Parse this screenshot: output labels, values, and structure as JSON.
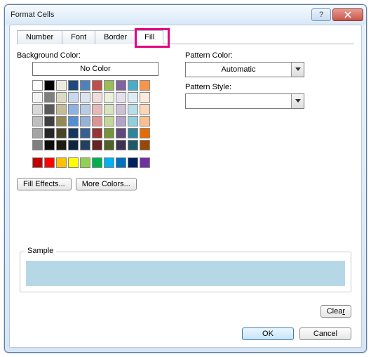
{
  "window": {
    "title": "Format Cells"
  },
  "tabs": {
    "number": "Number",
    "font": "Font",
    "border": "Border",
    "fill": "Fill",
    "active": "fill"
  },
  "fill": {
    "bg_label": "Background Color:",
    "no_color": "No Color",
    "effects_btn": "Fill Effects...",
    "more_colors_btn": "More Colors...",
    "selected_color": "#b6d8e6",
    "theme_colors": [
      [
        "#ffffff",
        "#000000",
        "#eeece1",
        "#1f497d",
        "#4f81bd",
        "#c0504d",
        "#9bbb59",
        "#8064a2",
        "#4bacc6",
        "#f79646"
      ],
      [
        "#f2f2f2",
        "#7f7f7f",
        "#ddd9c3",
        "#c6d9f0",
        "#dbe5f1",
        "#f2dcdb",
        "#ebf1dd",
        "#e5e0ec",
        "#dbeef3",
        "#fdeada"
      ],
      [
        "#d8d8d8",
        "#595959",
        "#c4bd97",
        "#8db3e2",
        "#b8cce4",
        "#e5b9b7",
        "#d7e3bc",
        "#ccc1d9",
        "#b7dde8",
        "#fbd5b5"
      ],
      [
        "#bfbfbf",
        "#3f3f3f",
        "#938953",
        "#548dd4",
        "#95b3d7",
        "#d99694",
        "#c3d69b",
        "#b2a2c7",
        "#92cddc",
        "#fac08f"
      ],
      [
        "#a5a5a5",
        "#262626",
        "#494429",
        "#17365d",
        "#366092",
        "#953734",
        "#76923c",
        "#5f497a",
        "#31859b",
        "#e36c09"
      ],
      [
        "#7f7f7f",
        "#0c0c0c",
        "#1d1b10",
        "#0f243e",
        "#244061",
        "#632423",
        "#4f6128",
        "#3f3151",
        "#205867",
        "#974806"
      ]
    ],
    "standard_colors": [
      "#c00000",
      "#ff0000",
      "#ffc000",
      "#ffff00",
      "#92d050",
      "#00b050",
      "#00b0f0",
      "#0070c0",
      "#002060",
      "#7030a0"
    ]
  },
  "pattern": {
    "color_label": "Pattern Color:",
    "color_value": "Automatic",
    "style_label": "Pattern Style:",
    "style_value": ""
  },
  "sample": {
    "label": "Sample",
    "color": "#b6d8e6"
  },
  "buttons": {
    "clear": "Clear",
    "ok": "OK",
    "cancel": "Cancel"
  }
}
